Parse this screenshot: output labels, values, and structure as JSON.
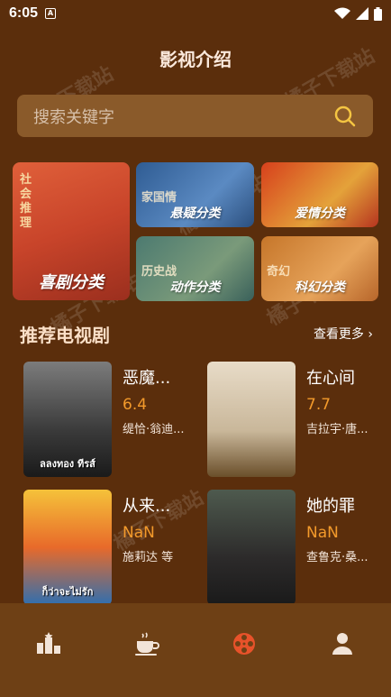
{
  "status_bar": {
    "time": "6:05",
    "notification_icon": "A",
    "wifi_icon": "wifi-icon",
    "signal_icon": "signal-icon",
    "battery_icon": "battery-icon"
  },
  "header": {
    "title": "影视介绍"
  },
  "search": {
    "placeholder": "搜索关键字",
    "icon": "search-icon"
  },
  "categories": [
    {
      "label": "喜剧分类",
      "side_text": "社会推理"
    },
    {
      "label": "悬疑分类",
      "overlay": "家国情"
    },
    {
      "label": "爱情分类"
    },
    {
      "label": "动作分类",
      "overlay": "历史战"
    },
    {
      "label": "科幻分类",
      "overlay": "奇幻"
    }
  ],
  "section": {
    "title": "推荐电视剧",
    "more": "查看更多 ›"
  },
  "shows": [
    {
      "name": "恶魔...",
      "score": "6.4",
      "cast": "缇恰·翁迪...",
      "poster_text": "ลลงทอง ทีรส์"
    },
    {
      "name": "在心间",
      "score": "7.7",
      "cast": "吉拉宇·唐...",
      "poster_text": ""
    },
    {
      "name": "从来...",
      "score": "NaN",
      "cast": "施莉达 等",
      "poster_text": "ก็ว่าจะไม่รัก"
    },
    {
      "name": "她的罪",
      "score": "NaN",
      "cast": "查鲁克·桑...",
      "poster_text": ""
    }
  ],
  "tabbar": {
    "tabs": [
      {
        "icon": "ranking-icon"
      },
      {
        "icon": "coffee-cup-icon"
      },
      {
        "icon": "film-reel-icon",
        "active": true
      },
      {
        "icon": "user-icon"
      }
    ],
    "active_color": "#e8522a",
    "inactive_color": "#f2e4d8"
  },
  "watermark": "橘子下载站"
}
